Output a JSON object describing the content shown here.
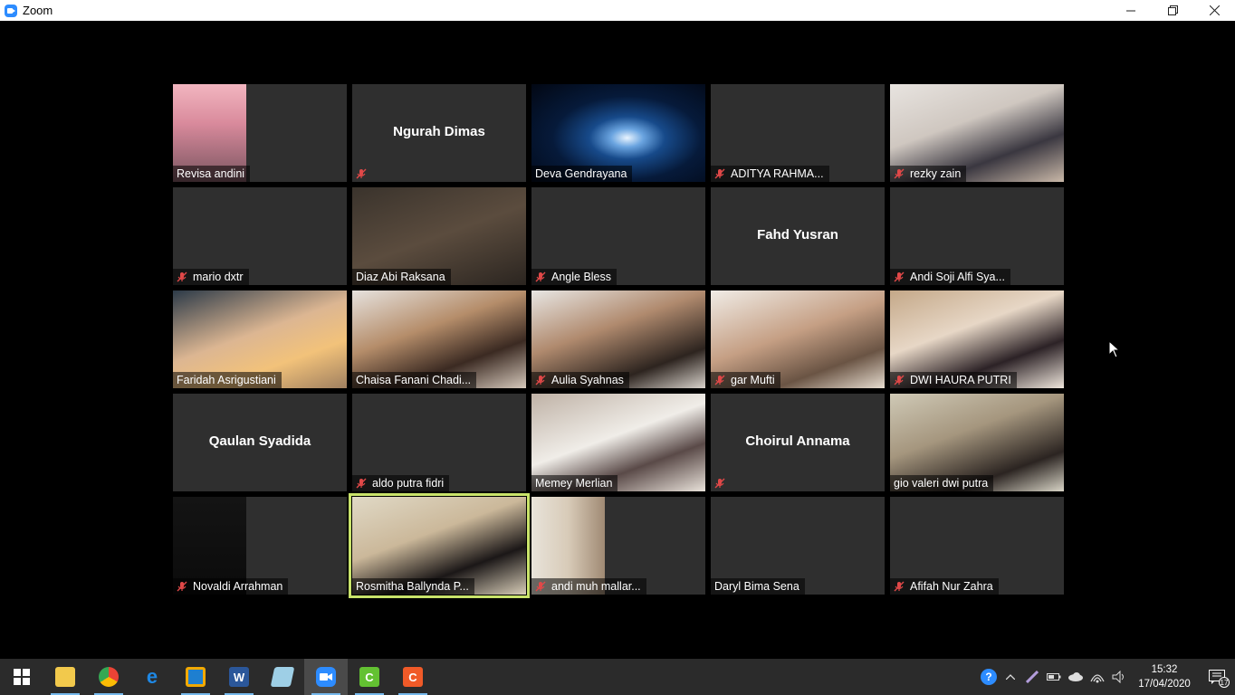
{
  "window": {
    "title": "Zoom",
    "controls": [
      "minimize",
      "restore",
      "close"
    ]
  },
  "participants": [
    {
      "name": "Revisa andini",
      "label": "",
      "muted": false,
      "video": "v-portrait",
      "inset": true
    },
    {
      "name": "",
      "label": "Ngurah Dimas",
      "muted": true,
      "video": ""
    },
    {
      "name": "Deva Gendrayana",
      "label": "",
      "muted": false,
      "video": "v-space"
    },
    {
      "name": "ADITYA RAHMA...",
      "label": "",
      "muted": true,
      "video": ""
    },
    {
      "name": "rezky zain",
      "label": "",
      "muted": true,
      "video": "v-girl1"
    },
    {
      "name": "mario dxtr",
      "label": "",
      "muted": true,
      "video": ""
    },
    {
      "name": "Diaz Abi Raksana",
      "label": "",
      "muted": false,
      "video": "v-dim"
    },
    {
      "name": "Angle Bless",
      "label": "",
      "muted": true,
      "video": ""
    },
    {
      "name": "",
      "label": "Fahd Yusran",
      "muted": false,
      "video": ""
    },
    {
      "name": "Andi Soji Alfi Sya...",
      "label": "",
      "muted": true,
      "video": ""
    },
    {
      "name": "Faridah Asrigustiani",
      "label": "",
      "muted": false,
      "video": "v-room1"
    },
    {
      "name": "Chaisa Fanani Chadi...",
      "label": "",
      "muted": false,
      "video": "v-room2"
    },
    {
      "name": "Aulia Syahnas",
      "label": "",
      "muted": true,
      "video": "v-boy1"
    },
    {
      "name": "gar Mufti",
      "label": "",
      "muted": true,
      "video": "v-boy2"
    },
    {
      "name": "DWI HAURA PUTRI",
      "label": "",
      "muted": true,
      "video": "v-girl2"
    },
    {
      "name": "",
      "label": "Qaulan Syadida",
      "muted": false,
      "video": ""
    },
    {
      "name": "aldo putra fidri",
      "label": "",
      "muted": true,
      "video": ""
    },
    {
      "name": "Memey Merlian",
      "label": "",
      "muted": false,
      "video": "v-girl3"
    },
    {
      "name": "",
      "label": "Choirul Annama",
      "muted": true,
      "video": ""
    },
    {
      "name": "gio valeri dwi putra",
      "label": "",
      "muted": false,
      "video": "v-boy3"
    },
    {
      "name": "Novaldi Arrahman",
      "label": "",
      "muted": true,
      "video": "v-dark",
      "inset": true
    },
    {
      "name": "Rosmitha Ballynda P...",
      "label": "",
      "muted": false,
      "video": "v-girl4",
      "active": true
    },
    {
      "name": "andi muh mallar...",
      "label": "",
      "muted": true,
      "video": "v-door",
      "inset": true
    },
    {
      "name": "Daryl Bima Sena",
      "label": "",
      "muted": false,
      "video": ""
    },
    {
      "name": "Afifah Nur Zahra",
      "label": "",
      "muted": true,
      "video": ""
    }
  ],
  "taskbar": {
    "apps": [
      {
        "id": "start",
        "icon": "windows-start-icon"
      },
      {
        "id": "explorer",
        "icon": "file-explorer-icon",
        "color": "#f2c94c"
      },
      {
        "id": "chrome",
        "icon": "chrome-icon",
        "color": "#ea4335"
      },
      {
        "id": "edge",
        "icon": "edge-icon",
        "color": "#1e88e5"
      },
      {
        "id": "app-box",
        "icon": "windows-app-icon",
        "color": "#f2a900"
      },
      {
        "id": "word",
        "icon": "word-icon",
        "color": "#2b579a",
        "letter": "W"
      },
      {
        "id": "notes",
        "icon": "notes-icon",
        "color": "#9ecfe6"
      },
      {
        "id": "zoom",
        "icon": "zoom-icon",
        "color": "#2d8cff"
      },
      {
        "id": "camtasia-green",
        "icon": "camtasia-green-icon",
        "color": "#63c132",
        "letter": "C"
      },
      {
        "id": "camtasia-orange",
        "icon": "camtasia-orange-icon",
        "color": "#f05a28",
        "letter": "C"
      }
    ],
    "clock": {
      "time": "15:32",
      "date": "17/04/2020"
    },
    "notification_count": "17"
  }
}
